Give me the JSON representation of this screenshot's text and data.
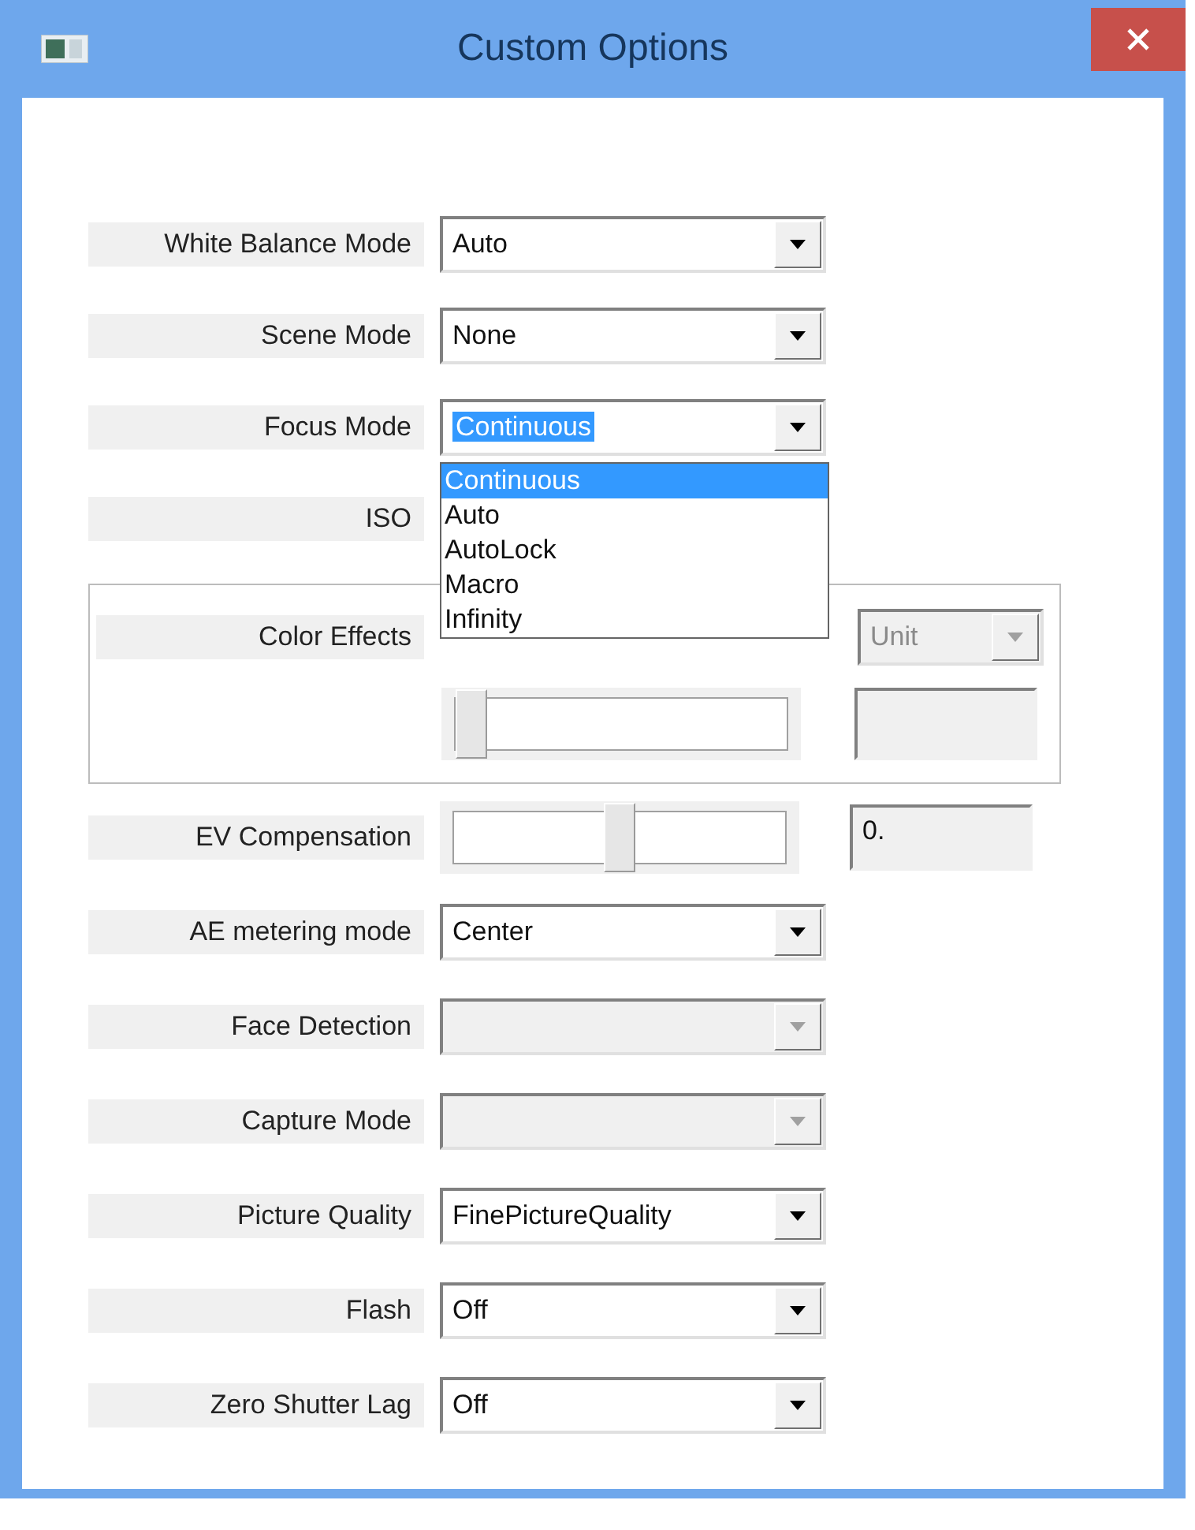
{
  "window": {
    "title": "Custom Options"
  },
  "rows": [
    {
      "kind": "combo",
      "label": "White Balance Mode",
      "value": "Auto",
      "disabled": false
    },
    {
      "kind": "combo",
      "label": "Scene Mode",
      "value": "None",
      "disabled": false
    },
    {
      "kind": "combo",
      "label": "Focus Mode",
      "value": "Continuous",
      "disabled": false,
      "open": true,
      "options": [
        {
          "label": "Continuous",
          "selected": true
        },
        {
          "label": "Auto",
          "selected": false
        },
        {
          "label": "AutoLock",
          "selected": false
        },
        {
          "label": "Macro",
          "selected": false
        },
        {
          "label": "Infinity",
          "selected": false
        }
      ]
    },
    {
      "kind": "label",
      "label": "ISO"
    },
    {
      "kind": "group",
      "label": "Color Effects",
      "unit": {
        "value": "Unit",
        "disabled": true
      },
      "level": 0
    },
    {
      "kind": "slider",
      "label": "EV Compensation",
      "level": 0.5,
      "reading": "0."
    },
    {
      "kind": "combo",
      "label": "AE metering mode",
      "value": "Center",
      "disabled": false
    },
    {
      "kind": "combo",
      "label": "Face Detection",
      "disabled": true
    },
    {
      "kind": "combo",
      "label": "Capture Mode",
      "disabled": true
    },
    {
      "kind": "combo",
      "label": "Picture Quality",
      "value": "FinePictureQuality",
      "disabled": false
    },
    {
      "kind": "combo",
      "label": "Flash",
      "value": "Off",
      "disabled": false
    },
    {
      "kind": "combo",
      "label": "Zero Shutter Lag",
      "value": "Off",
      "disabled": false
    }
  ]
}
